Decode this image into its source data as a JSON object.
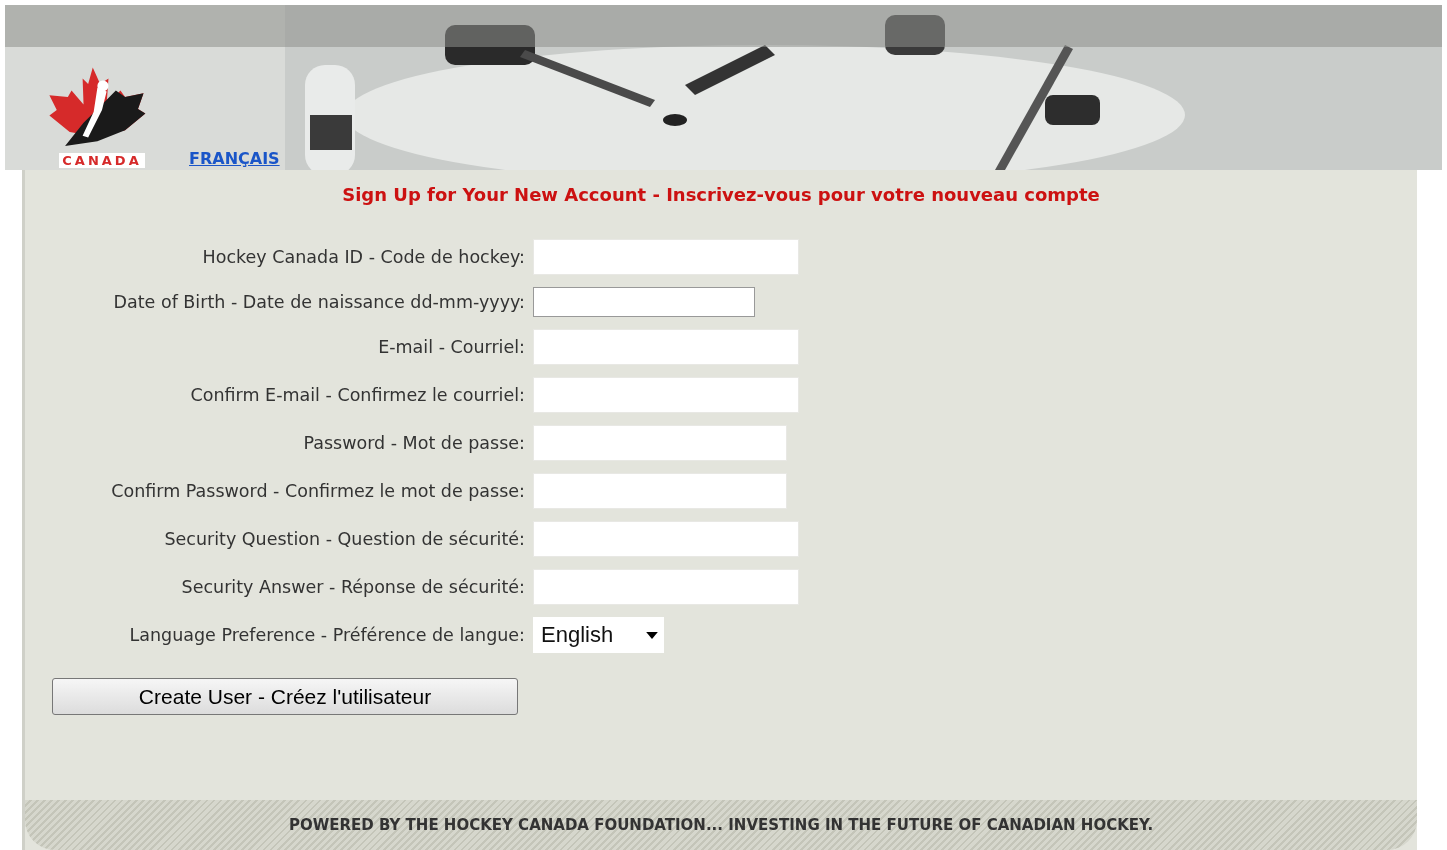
{
  "header": {
    "logo_text": "CANADA",
    "language_link": "FRANÇAIS"
  },
  "title": "Sign Up for Your New Account - Inscrivez-vous pour votre nouveau compte",
  "fields": [
    {
      "kind": "text",
      "label": "Hockey Canada ID - Code de hockey:"
    },
    {
      "kind": "text",
      "label": "Date of Birth - Date de naissance dd-mm-yyyy:"
    },
    {
      "kind": "text",
      "label": "E-mail - Courriel:"
    },
    {
      "kind": "text",
      "label": "Confirm E-mail - Confirmez le courriel:"
    },
    {
      "kind": "password",
      "label": "Password - Mot de passe:"
    },
    {
      "kind": "password",
      "label": "Confirm Password - Confirmez le mot de passe:"
    },
    {
      "kind": "text",
      "label": "Security Question - Question de sécurité:"
    },
    {
      "kind": "text",
      "label": "Security Answer - Réponse de sécurité:"
    },
    {
      "kind": "select",
      "label": "Language Preference - Préférence de langue:",
      "value": "English"
    }
  ],
  "submit_button": "Create User - Créez l'utilisateur",
  "footer": "POWERED BY THE HOCKEY CANADA FOUNDATION... INVESTING IN THE FUTURE OF CANADIAN HOCKEY."
}
